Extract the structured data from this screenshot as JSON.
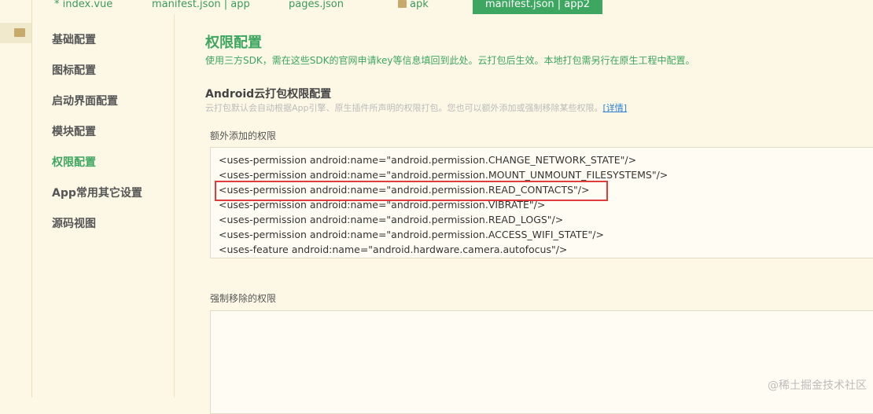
{
  "tabs": [
    "* index.vue",
    "manifest.json | app",
    "pages.json",
    "apk",
    "manifest.json | app2"
  ],
  "nav": [
    "基础配置",
    "图标配置",
    "启动界面配置",
    "模块配置",
    "权限配置",
    "App常用其它设置",
    "源码视图"
  ],
  "title": "权限配置",
  "subtitle": "使用三方SDK，需在这些SDK的官网申请key等信息填回到此处。云打包后生效。本地打包需另行在原生工程中配置。",
  "section_title": "Android云打包权限配置",
  "hint": "云打包默认会自动根据App引擎、原生插件所声明的权限打包。您也可以额外添加或强制移除某些权限。",
  "hint_link": "[详情]",
  "extra_label": "额外添加的权限",
  "extra_lines": [
    "<uses-permission android:name=\"android.permission.CHANGE_NETWORK_STATE\"/>",
    "<uses-permission android:name=\"android.permission.MOUNT_UNMOUNT_FILESYSTEMS\"/>",
    "<uses-permission android:name=\"android.permission.READ_CONTACTS\"/>",
    "<uses-permission android:name=\"android.permission.VIBRATE\"/>",
    "<uses-permission android:name=\"android.permission.READ_LOGS\"/>",
    "<uses-permission android:name=\"android.permission.ACCESS_WIFI_STATE\"/>",
    "<uses-feature android:name=\"android.hardware.camera.autofocus\"/>"
  ],
  "remove_label": "强制移除的权限",
  "watermark": "@稀土掘金技术社区"
}
